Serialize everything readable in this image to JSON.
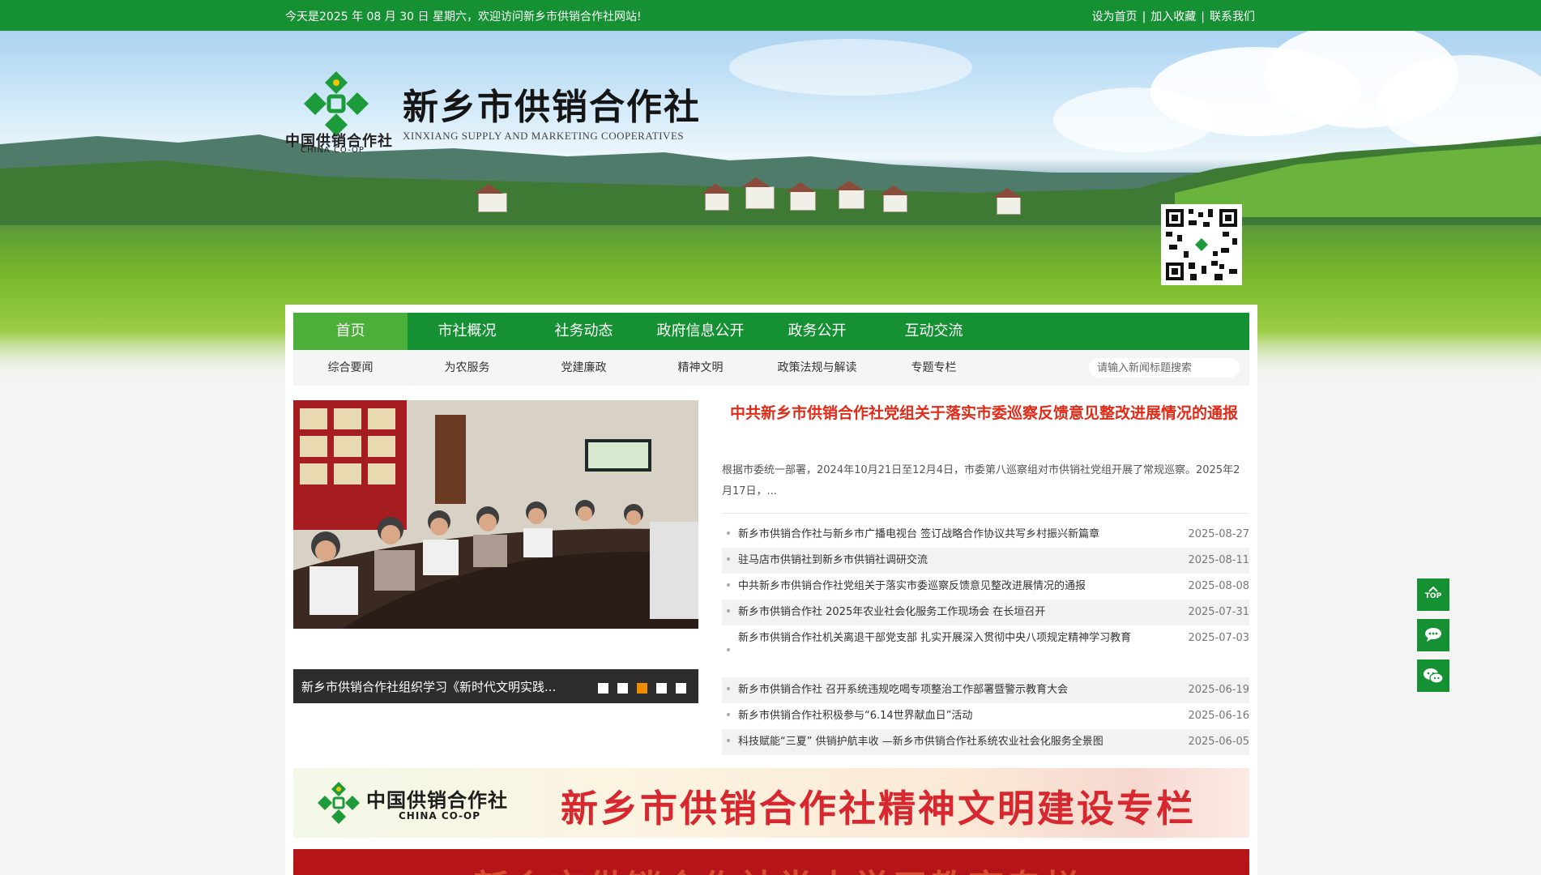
{
  "topbar": {
    "welcome": "今天是2025 年 08 月 30 日 星期六，欢迎访问新乡市供销合作社网站!",
    "links": [
      "设为首页",
      "加入收藏",
      "联系我们"
    ]
  },
  "header": {
    "logo_cn": "中国供销合作社",
    "logo_en": "CHINA CO-OP",
    "title": "新乡市供销合作社",
    "subtitle": "XINXIANG SUPPLY AND MARKETING COOPERATIVES",
    "qr_icon": "qr-code-icon"
  },
  "nav": {
    "items": [
      "首页",
      "市社概况",
      "社务动态",
      "政府信息公开",
      "政务公开",
      "互动交流"
    ],
    "active_index": 0
  },
  "subnav": {
    "items": [
      "综合要闻",
      "为农服务",
      "党建廉政",
      "精神文明",
      "政策法规与解读",
      "专题专栏"
    ],
    "search_placeholder": "请输入新闻标题搜索"
  },
  "slider": {
    "caption": "新乡市供销合作社组织学习《新时代文明实践...",
    "dot_count": 5,
    "active_dot": 2
  },
  "headline": {
    "title": "中共新乡市供销合作社党组关于落实市委巡察反馈意见整改进展情况的通报",
    "summary": "根据市委统一部署，2024年10月21日至12月4日，市委第八巡察组对市供销社党组开展了常规巡察。2025年2月17日，..."
  },
  "news": [
    {
      "title": "新乡市供销合作社与新乡市广播电视台 签订战略合作协议共写乡村振兴新篇章",
      "date": "2025-08-27"
    },
    {
      "title": "驻马店市供销社到新乡市供销社调研交流",
      "date": "2025-08-11"
    },
    {
      "title": "中共新乡市供销合作社党组关于落实市委巡察反馈意见整改进展情况的通报",
      "date": "2025-08-08"
    },
    {
      "title": "新乡市供销合作社 2025年农业社会化服务工作现场会 在长垣召开",
      "date": "2025-07-31"
    },
    {
      "title": "新乡市供销合作社机关离退干部党支部 扎实开展深入贯彻中央八项规定精神学习教育",
      "date": "2025-07-03"
    },
    {
      "title": "新乡市供销合作社 召开系统违规吃喝专项整治工作部署暨警示教育大会",
      "date": "2025-06-19"
    },
    {
      "title": "新乡市供销合作社积极参与“6.14世界献血日”活动",
      "date": "2025-06-16"
    },
    {
      "title": "科技赋能“三夏” 供销护航丰收 —新乡市供销合作社系统农业社会化服务全景图",
      "date": "2025-06-05"
    }
  ],
  "promo": {
    "banner1_logo_cn": "中国供销合作社",
    "banner1_logo_en": "CHINA CO-OP",
    "banner1_title": "新乡市供销合作社精神文明建设专栏",
    "banner2_title": "新乡市供销合作社党史学习教育专栏"
  },
  "side": {
    "top_label": "TOP",
    "icons": [
      "back-to-top-icon",
      "chat-bubble-icon",
      "wechat-icon"
    ]
  },
  "colors": {
    "brand_green": "#159033",
    "nav_active": "#4caf39",
    "headline_red": "#e02b18",
    "dot_active": "#f08c00"
  }
}
